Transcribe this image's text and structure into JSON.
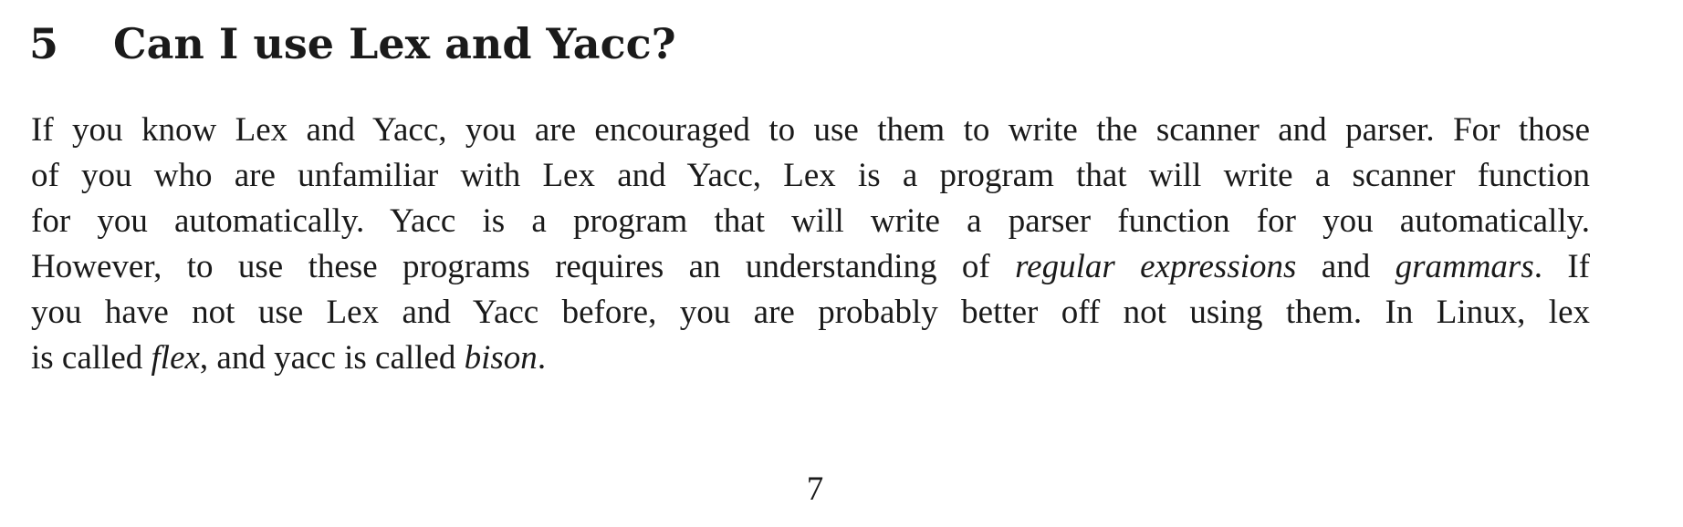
{
  "section": {
    "number": "5",
    "title": "Can I use Lex and Yacc?"
  },
  "paragraph": {
    "line1": "If you know Lex and Yacc, you are encouraged to use them to write the scanner and parser. For those",
    "line2": "of you who are unfamiliar with Lex and Yacc, Lex is a program that will write a scanner function",
    "line3": "for you automatically. Yacc is a program that will write a parser function for you automatically.",
    "line4_a": "However, to use these programs requires an understanding of ",
    "line4_em1": "regular expressions",
    "line4_b": " and ",
    "line4_em2": "grammars",
    "line4_c": ". If",
    "line5": "you have not use Lex and Yacc before, you are probably better off not using them. In Linux, lex",
    "line6_a": "is called ",
    "line6_em1": "flex",
    "line6_b": ", and yacc is called ",
    "line6_em2": "bison",
    "line6_c": "."
  },
  "footer": {
    "page_number": "7"
  }
}
